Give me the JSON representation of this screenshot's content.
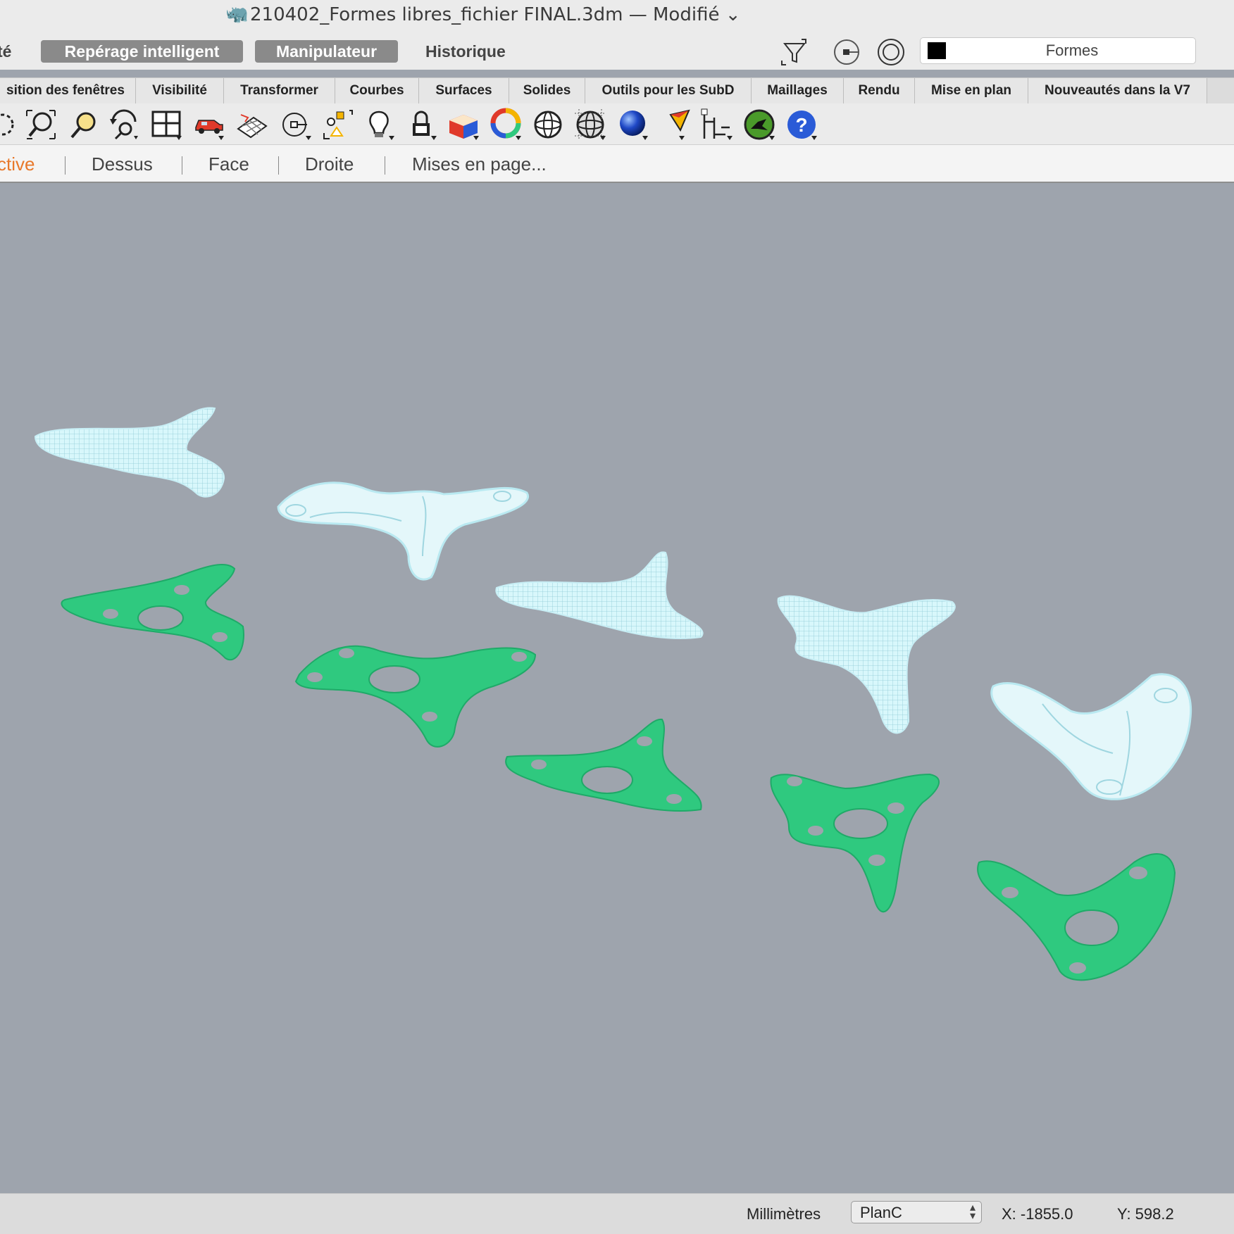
{
  "window": {
    "title": "210402_Formes libres_fichier FINAL.3dm — Modifié",
    "title_chevron": "⌄"
  },
  "toolbar": {
    "cut_label": "té",
    "smart_track": "Repérage intelligent",
    "gumball": "Manipulateur",
    "history": "Historique",
    "icons": [
      "filter-icon",
      "osnap-icon",
      "target-icon"
    ],
    "layer_name": "Formes",
    "layer_color": "#000000"
  },
  "tabs": [
    "sition des fenêtres",
    "Visibilité",
    "Transformer",
    "Courbes",
    "Surfaces",
    "Solides",
    "Outils pour les SubD",
    "Maillages",
    "Rendu",
    "Mise en plan",
    "Nouveautés dans la V7"
  ],
  "tool_icons": [
    "select-window-icon",
    "zoom-extents-icon",
    "zoom-window-icon",
    "rotate-view-icon",
    "viewport-layout-icon",
    "car-icon",
    "grid-perspective-icon",
    "circle-center-icon",
    "shapes-icon",
    "lightbulb-icon",
    "lock-icon",
    "boolean-box-icon",
    "color-wheel-icon",
    "wireframe-sphere-icon",
    "mesh-sphere-icon",
    "render-sphere-icon",
    "cone-pen-icon",
    "dimension-icon",
    "grasshopper-icon",
    "help-icon"
  ],
  "views": {
    "active": "ctive",
    "top": "Dessus",
    "front": "Face",
    "right": "Droite",
    "layouts": "Mises en page..."
  },
  "colors": {
    "active_view": "#e8782a",
    "solid_fill": "#2fc97f",
    "wire_fill": "#d8f7fb",
    "viewport_bg": "#9ea4ad"
  },
  "status": {
    "units": "Millimètres",
    "cplane": "PlanC",
    "x": "X: -1855.0",
    "y": "Y: 598.2"
  }
}
